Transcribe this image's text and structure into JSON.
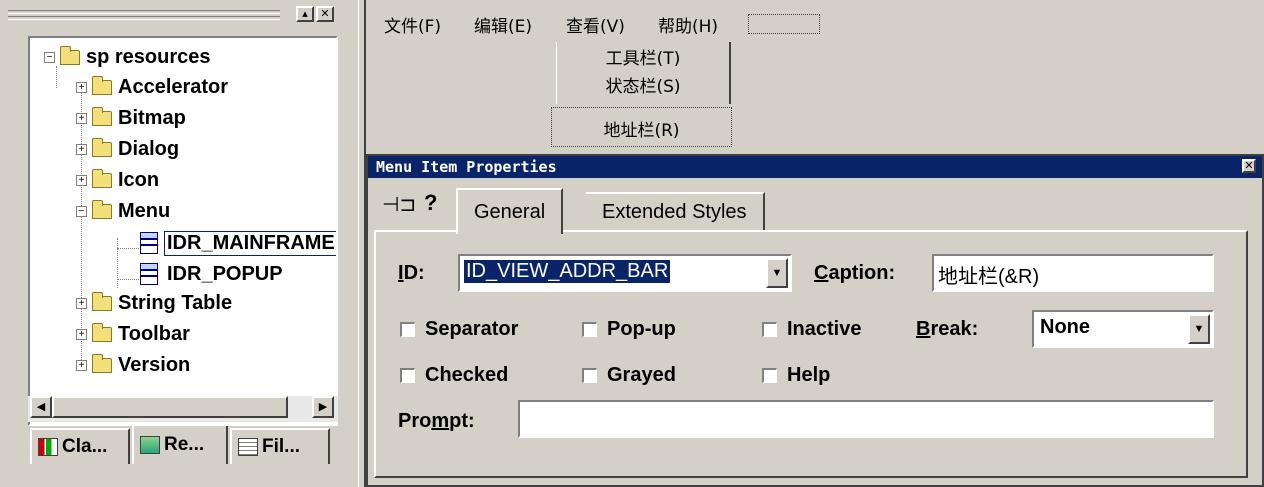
{
  "workspace": {
    "tree": {
      "root": "sp resources",
      "items": [
        "Accelerator",
        "Bitmap",
        "Dialog",
        "Icon",
        "Menu",
        "String Table",
        "Toolbar",
        "Version"
      ],
      "menu_children": [
        "IDR_MAINFRAME",
        "IDR_POPUP"
      ]
    },
    "tabs": [
      "Cla...",
      "Re...",
      "Fil..."
    ]
  },
  "menubar": {
    "items": [
      "文件(F)",
      "编辑(E)",
      "查看(V)",
      "帮助(H)"
    ],
    "view_dropdown": [
      "工具栏(T)",
      "状态栏(S)",
      "地址栏(R)"
    ]
  },
  "dialog": {
    "title": "Menu Item Properties",
    "pin_icon": "pushpin-icon",
    "help_icon": "question-mark-icon",
    "tabs": [
      "General",
      "Extended Styles"
    ],
    "active_tab": "General",
    "id_label": "ID:",
    "id_value": "ID_VIEW_ADDR_BAR",
    "caption_label": "Caption:",
    "caption_value": "地址栏(&R)",
    "checkboxes": {
      "separator": "Separator",
      "popup": "Pop-up",
      "inactive": "Inactive",
      "checked": "Checked",
      "grayed": "Grayed",
      "help": "Help"
    },
    "break_label": "Break:",
    "break_value": "None",
    "prompt_label": "Prompt:",
    "prompt_value": "",
    "colors": {
      "titlebar": "#0a246a",
      "selection": "#0a246a",
      "face": "#d4d0c8"
    }
  }
}
